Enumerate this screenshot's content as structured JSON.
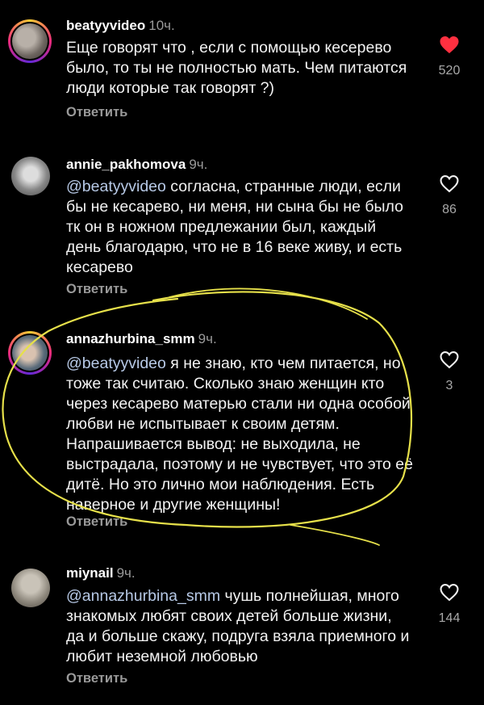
{
  "comments": [
    {
      "username": "beatyyvideo",
      "time": "10ч.",
      "mention": "",
      "text": "Еще говорят что , если с помощью кесерево было, то ты не полностью мать. Чем питаются люди которые так говорят ?)",
      "reply": "Ответить",
      "likes": "520",
      "liked": true
    },
    {
      "username": "annie_pakhomova",
      "time": "9ч.",
      "mention": "@beatyyvideo",
      "text": " согласна, странные люди, если бы не кесарево, ни меня, ни сына бы не было тк он в ножном предлежании был, каждый день благодарю, что не в 16 веке живу, и есть кесарево",
      "reply": "Ответить",
      "likes": "86",
      "liked": false
    },
    {
      "username": "annazhurbina_smm",
      "time": "9ч.",
      "mention": "@beatyyvideo",
      "text": " я не знаю, кто чем питается, но тоже так считаю. Сколько знаю женщин кто через кесарево матерью стали ни одна особой любви не испытывает к своим детям. Напрашивается вывод: не выходила, не выстрадала, поэтому и не чувствует, что это её дитё. Но это лично мои наблюдения. Есть наверное и другие женщины!",
      "reply": "Ответить",
      "likes": "3",
      "liked": false
    },
    {
      "username": "miynail",
      "time": "9ч.",
      "mention": "@annazhurbina_smm",
      "text": " чушь полнейшая, много знакомых любят своих детей больше жизни, да и больше скажу, подруга взяла приемного и любит неземной любовью",
      "reply": "Ответить",
      "likes": "144",
      "liked": false
    }
  ],
  "colors": {
    "background": "#000000",
    "like_active": "#ff3040",
    "mention": "#b7c9e6",
    "highlight_stroke": "#e6e04a"
  },
  "icons": {
    "like": "heart-icon",
    "like_filled": "heart-filled-icon"
  }
}
